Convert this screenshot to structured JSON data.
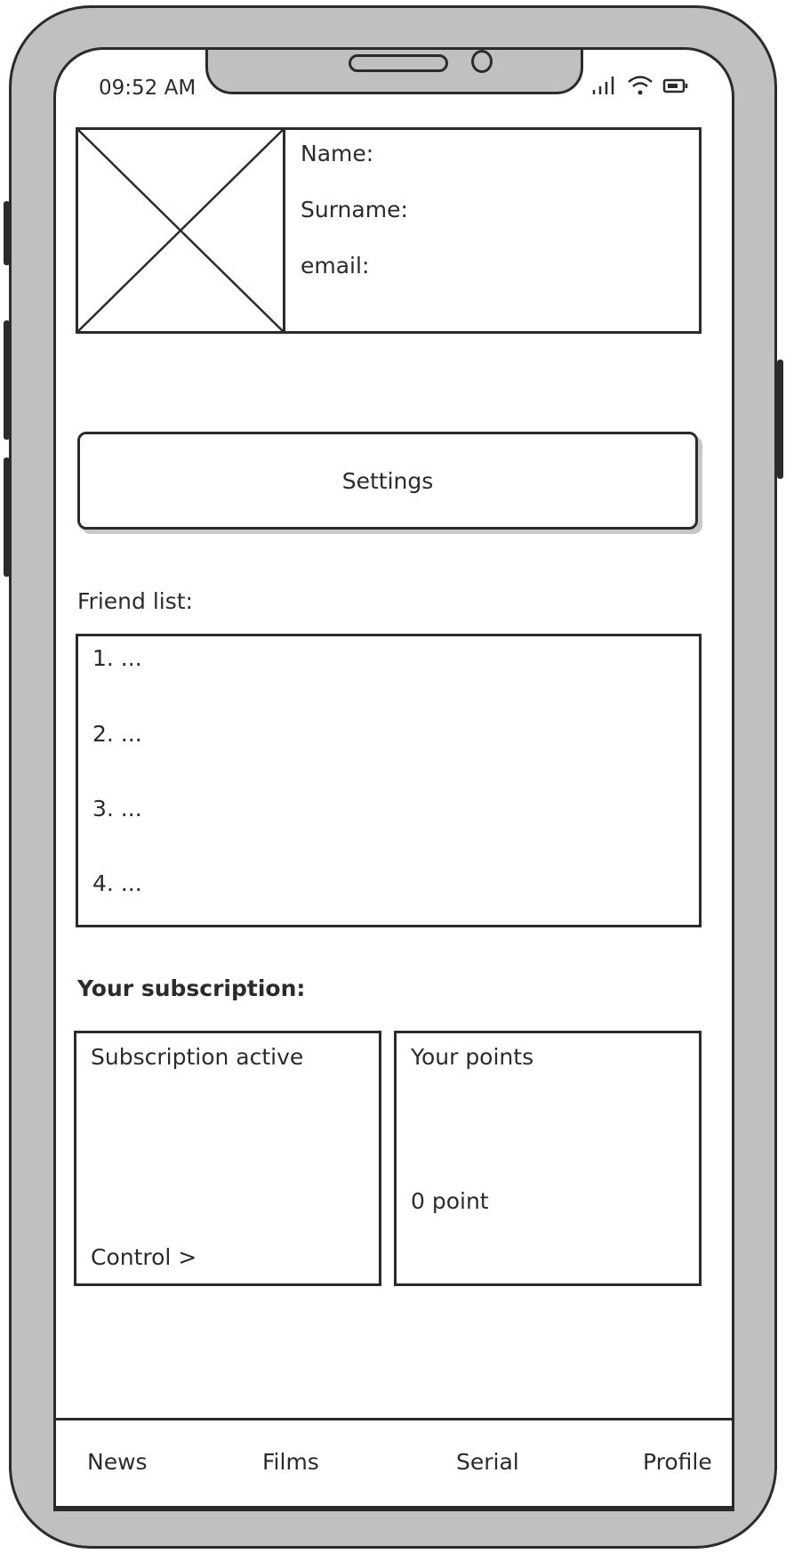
{
  "status_bar": {
    "time": "09:52 AM",
    "icons": [
      "signal-icon",
      "wifi-icon",
      "battery-icon"
    ]
  },
  "profile": {
    "image_placeholder": "image-placeholder-icon",
    "name_label": "Name:",
    "surname_label": "Surname:",
    "email_label": "email:"
  },
  "settings": {
    "label": "Settings"
  },
  "friends": {
    "heading": "Friend list:",
    "items": [
      "1. ...",
      "2. ...",
      "3. ...",
      "4. ..."
    ]
  },
  "subscription": {
    "heading": "Your subscription:",
    "status_card": {
      "title": "Subscription active",
      "link": "Control >"
    },
    "points_card": {
      "title": "Your points",
      "value": "0 point"
    }
  },
  "tabbar": {
    "tabs": [
      "News",
      "Films",
      "Serial",
      "Profile"
    ]
  },
  "colors": {
    "ink": "#2b2b2b",
    "frame": "#c0c0c0",
    "screen": "#ffffff"
  }
}
